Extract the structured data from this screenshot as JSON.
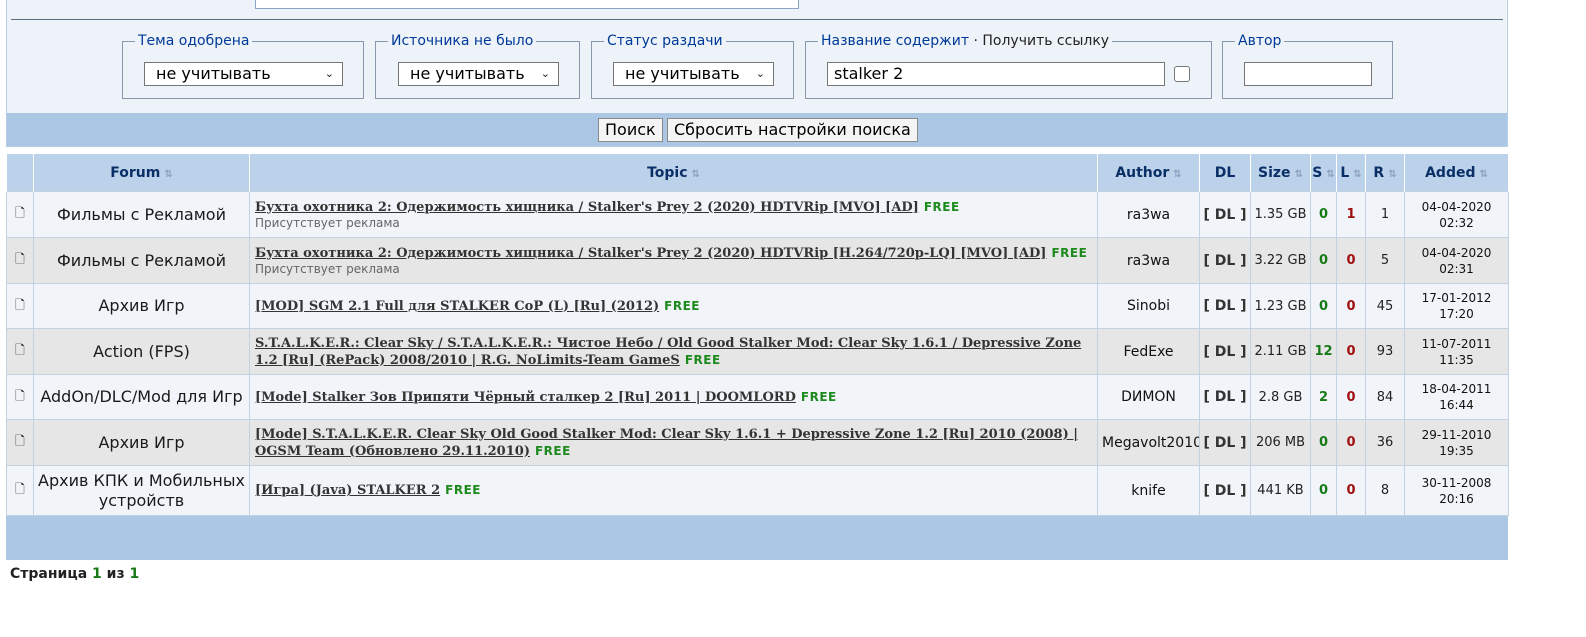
{
  "filters": {
    "approved": {
      "legend": "Тема одобрена",
      "value": "не учитывать"
    },
    "no_source": {
      "legend": "Источника не было",
      "value": "не учитывать"
    },
    "status": {
      "legend": "Статус раздачи",
      "value": "не учитывать"
    },
    "title": {
      "legend": "Название содержит",
      "separator": "·",
      "link_label": "Получить ссылку",
      "value": "stalker 2"
    },
    "author": {
      "legend": "Автор",
      "value": ""
    }
  },
  "buttons": {
    "search": "Поиск",
    "reset": "Сбросить настройки поиска"
  },
  "columns": {
    "forum": "Forum",
    "topic": "Topic",
    "author": "Author",
    "dl": "DL",
    "size": "Size",
    "s": "S",
    "l": "L",
    "r": "R",
    "added": "Added"
  },
  "sort_icon": "sort-arrows-icon",
  "file_icon": "🗋",
  "free_label": "FREE",
  "rows": [
    {
      "forum": "Фильмы с Рекламой",
      "topic": "Бухта охотника 2: Одержимость хищника / Stalker's Prey 2 (2020) HDTVRip [MVO] [AD]",
      "note": "Присутствует реклама",
      "author": "ra3wa",
      "dl": "[ DL ]",
      "size": "1.35 GB",
      "s": "0",
      "l": "1",
      "r": "1",
      "date": "04-04-2020",
      "time": "02:32"
    },
    {
      "forum": "Фильмы с Рекламой",
      "topic": "Бухта охотника 2: Одержимость хищника / Stalker's Prey 2 (2020) HDTVRip [H.264/720p-LQ] [MVO] [AD]",
      "note": "Присутствует реклама",
      "author": "ra3wa",
      "dl": "[ DL ]",
      "size": "3.22 GB",
      "s": "0",
      "l": "0",
      "r": "5",
      "date": "04-04-2020",
      "time": "02:31"
    },
    {
      "forum": "Архив Игр",
      "topic": "[MOD] SGM 2.1 Full для STALKER CoP (L) [Ru] (2012)",
      "note": "",
      "author": "Sinobi",
      "dl": "[ DL ]",
      "size": "1.23 GB",
      "s": "0",
      "l": "0",
      "r": "45",
      "date": "17-01-2012",
      "time": "17:20"
    },
    {
      "forum": "Action (FPS)",
      "topic": "S.T.A.L.K.E.R.: Clear Sky / S.T.A.L.K.E.R.: Чистое Небо / Old Good Stalker Mod: Clear Sky 1.6.1 / Depressive Zone 1.2 [Ru] (RePack) 2008/2010 | R.G. NoLimits-Team GameS",
      "note": "",
      "author": "FedExe",
      "dl": "[ DL ]",
      "size": "2.11 GB",
      "s": "12",
      "l": "0",
      "r": "93",
      "date": "11-07-2011",
      "time": "11:35"
    },
    {
      "forum": "AddOn/DLC/Mod для Игр",
      "topic": "[Mode] Stalker Зов Припяти Чёрный сталкер 2 [Ru] 2011 | DOOMLORD",
      "note": "",
      "author": "DИMON",
      "dl": "[ DL ]",
      "size": "2.8 GB",
      "s": "2",
      "l": "0",
      "r": "84",
      "date": "18-04-2011",
      "time": "16:44"
    },
    {
      "forum": "Архив Игр",
      "topic": "[Mode] S.T.A.L.K.E.R. Clear Sky Old Good Stalker Mod: Clear Sky 1.6.1 + Depressive Zone 1.2 [Ru] 2010 (2008) | OGSM Team (Обновлено 29.11.2010)",
      "note": "",
      "author": "Megavolt2010",
      "dl": "[ DL ]",
      "size": "206 MB",
      "s": "0",
      "l": "0",
      "r": "36",
      "date": "29-11-2010",
      "time": "19:35"
    },
    {
      "forum": "Архив КПК и Мобильных устройств",
      "topic": "[Игра] (Java) STALKER 2",
      "note": "",
      "author": "knife",
      "dl": "[ DL ]",
      "size": "441 KB",
      "s": "0",
      "l": "0",
      "r": "8",
      "date": "30-11-2008",
      "time": "20:16"
    }
  ],
  "pager": {
    "prefix": "Страница",
    "current": "1",
    "of": "из",
    "total": "1"
  },
  "colors": {
    "panel_bg": "#eef3f9",
    "bar_bg": "#abc7e4",
    "header_bg": "#bcd2ea",
    "seed": "#167a16",
    "leech": "#a01010",
    "free": "#1d8a1d"
  }
}
